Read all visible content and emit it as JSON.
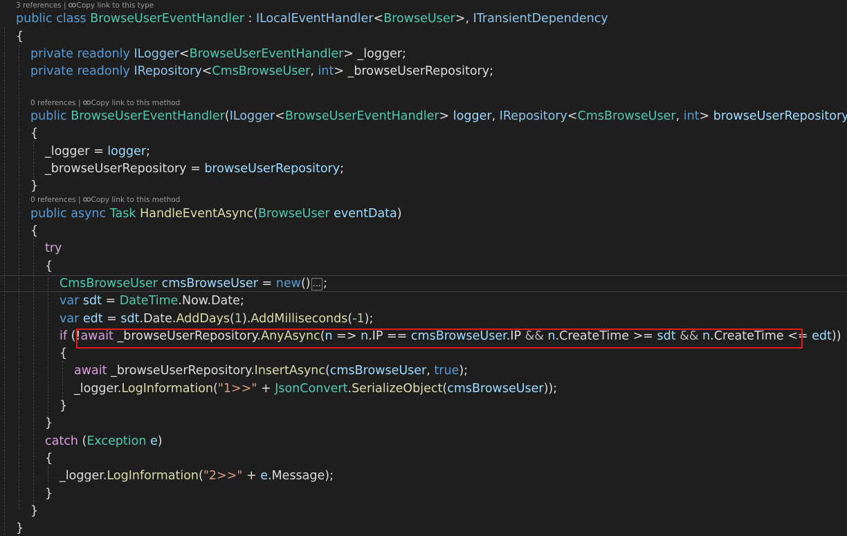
{
  "codelens": {
    "class_refs": "3 references",
    "ctor_refs": "0 references",
    "method_refs": "0 references",
    "sep": "|",
    "copy_type": "Copy link to this type",
    "copy_method": "Copy link to this method"
  },
  "tok": {
    "public": "public",
    "private": "private",
    "readonly": "readonly",
    "class": "class",
    "async": "async",
    "var": "var",
    "int": "int",
    "new": "new",
    "true": "true",
    "try": "try",
    "catch": "catch",
    "if": "if",
    "await": "await",
    "Task": "Task",
    "BrowseUserEventHandler": "BrowseUserEventHandler",
    "ILocalEventHandler": "ILocalEventHandler",
    "BrowseUser": "BrowseUser",
    "ITransientDependency": "ITransientDependency",
    "ILogger": "ILogger",
    "IRepository": "IRepository",
    "CmsBrowseUser": "CmsBrowseUser",
    "DateTime": "DateTime",
    "JsonConvert": "JsonConvert",
    "Exception": "Exception",
    "_logger": "_logger",
    "_browseUserRepository": "_browseUserRepository",
    "logger": "logger",
    "browseUserRepository": "browseUserRepository",
    "HandleEventAsync": "HandleEventAsync",
    "eventData": "eventData",
    "cmsBrowseUser": "cmsBrowseUser",
    "sdt": "sdt",
    "edt": "edt",
    "n": "n",
    "e": "e",
    "Now": "Now",
    "Date": "Date",
    "AddDays": "AddDays",
    "AddMilliseconds": "AddMilliseconds",
    "AnyAsync": "AnyAsync",
    "InsertAsync": "InsertAsync",
    "LogInformation": "LogInformation",
    "SerializeObject": "SerializeObject",
    "IP": "IP",
    "CreateTime": "CreateTime",
    "Message": "Message",
    "one": "1",
    "minus_one": "-1",
    "str1": "\"1>>\"",
    "str2": "\"2>>\"",
    "collapsed": "..."
  }
}
